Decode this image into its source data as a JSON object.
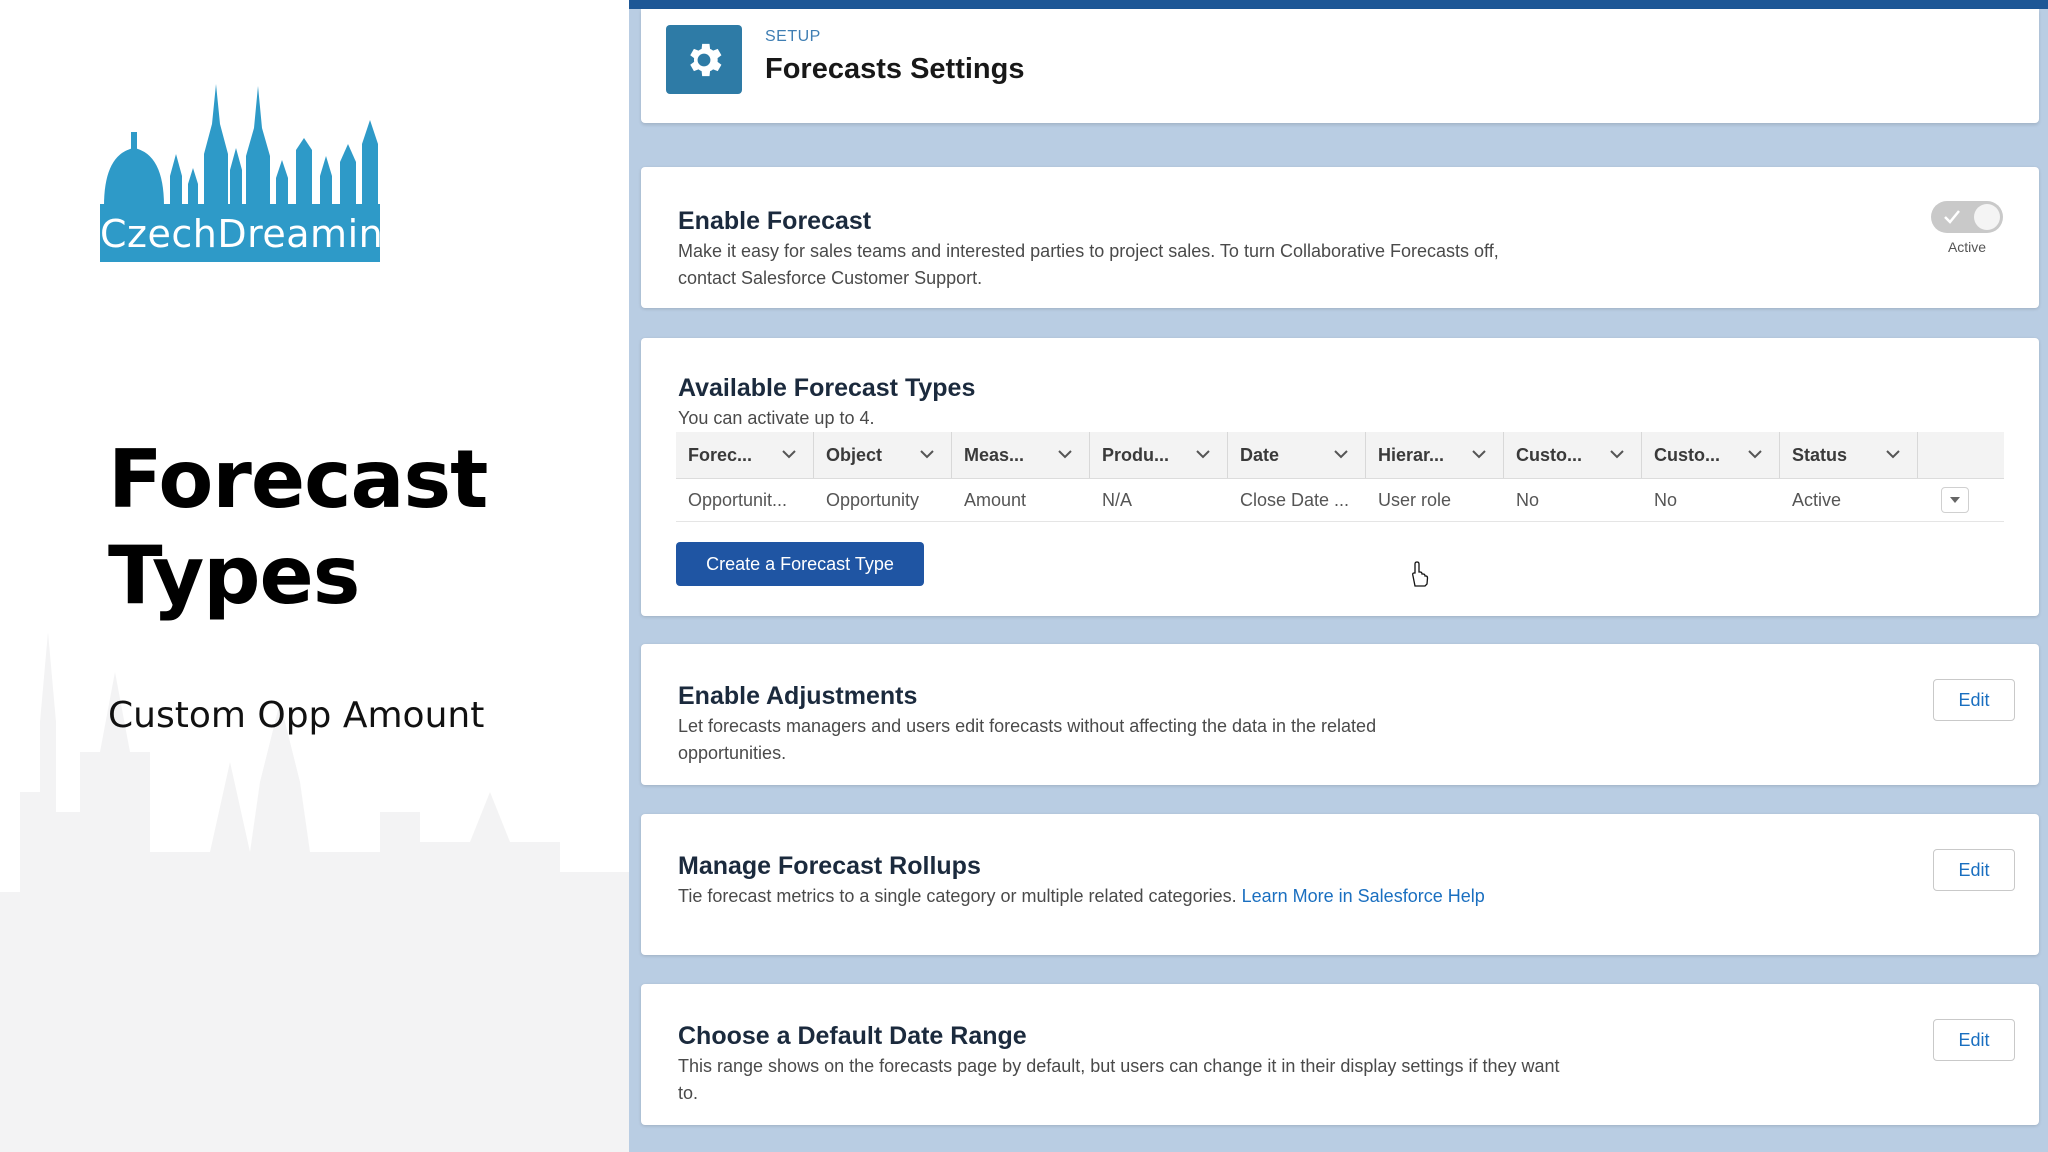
{
  "slide": {
    "logo_text": "CzechDreamin",
    "title_line1": "Forecast",
    "title_line2": "Types",
    "subtitle": "Custom Opp Amount"
  },
  "header": {
    "setup_label": "SETUP",
    "title": "Forecasts Settings",
    "icon": "gear-icon"
  },
  "enable_forecast": {
    "title": "Enable Forecast",
    "description": "Make it easy for sales teams and interested parties to project sales. To turn Collaborative Forecasts off, contact Salesforce Customer Support.",
    "toggle_label": "Active",
    "toggle_on": true
  },
  "forecast_types": {
    "title": "Available Forecast Types",
    "subtitle": "You can activate up to 4.",
    "columns": [
      "Forec...",
      "Object",
      "Meas...",
      "Produ...",
      "Date",
      "Hierar...",
      "Custo...",
      "Custo...",
      "Status"
    ],
    "rows": [
      [
        "Opportunit...",
        "Opportunity",
        "Amount",
        "N/A",
        "Close Date ...",
        "User role",
        "No",
        "No",
        "Active"
      ]
    ],
    "create_button": "Create a Forecast Type"
  },
  "adjustments": {
    "title": "Enable Adjustments",
    "description": "Let forecasts managers and users edit forecasts without affecting the data in the related opportunities.",
    "edit_label": "Edit"
  },
  "rollups": {
    "title": "Manage Forecast Rollups",
    "description": "Tie forecast metrics to a single category or multiple related categories.",
    "link": "Learn More in Salesforce Help",
    "edit_label": "Edit"
  },
  "date_range": {
    "title": "Choose a Default Date Range",
    "description": "This range shows on the forecasts page by default, but users can change it in their display settings if they want to.",
    "edit_label": "Edit"
  },
  "colors": {
    "brand_blue": "#2e9ac8",
    "primary_button": "#1f55a3",
    "page_background": "#b9cde3",
    "link": "#1a6fc0"
  }
}
